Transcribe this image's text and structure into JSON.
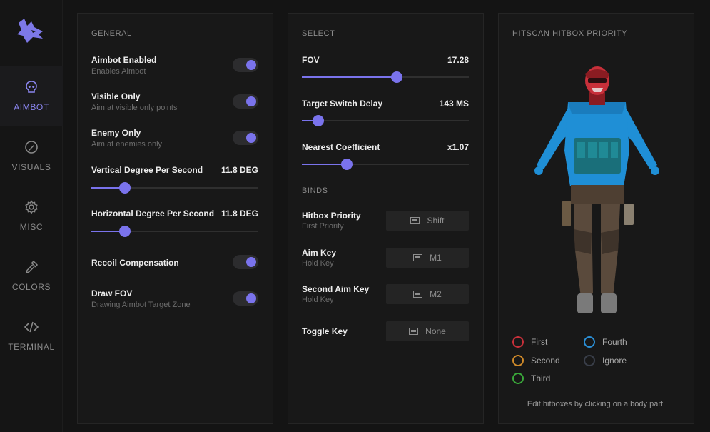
{
  "sidebar": {
    "items": [
      {
        "label": "AIMBOT",
        "icon": "skull-icon",
        "active": true
      },
      {
        "label": "VISUALS",
        "icon": "visuals-icon",
        "active": false
      },
      {
        "label": "MISC",
        "icon": "gear-icon",
        "active": false
      },
      {
        "label": "COLORS",
        "icon": "eyedropper-icon",
        "active": false
      },
      {
        "label": "TERMINAL",
        "icon": "code-icon",
        "active": false
      }
    ]
  },
  "general": {
    "title": "GENERAL",
    "aimbot_enabled": {
      "label": "Aimbot Enabled",
      "sub": "Enables Aimbot",
      "on": true
    },
    "visible_only": {
      "label": "Visible Only",
      "sub": "Aim at visible only points",
      "on": true
    },
    "enemy_only": {
      "label": "Enemy Only",
      "sub": "Aim at enemies only",
      "on": true
    },
    "vertical": {
      "label": "Vertical Degree Per Second",
      "value": "11.8 DEG",
      "fill": 0.2
    },
    "horizontal": {
      "label": "Horizontal Degree Per Second",
      "value": "11.8 DEG",
      "fill": 0.2
    },
    "recoil": {
      "label": "Recoil Compensation",
      "on": true
    },
    "draw_fov": {
      "label": "Draw FOV",
      "sub": "Drawing Aimbot Target Zone",
      "on": true
    }
  },
  "select": {
    "title": "SELECT",
    "fov": {
      "label": "FOV",
      "value": "17.28",
      "fill": 0.57
    },
    "switch_delay": {
      "label": "Target Switch Delay",
      "value": "143 MS",
      "fill": 0.1
    },
    "nearest": {
      "label": "Nearest Coefficient",
      "value": "x1.07",
      "fill": 0.27
    },
    "binds_title": "BINDS",
    "binds": [
      {
        "label": "Hitbox Priority",
        "sub": "First Priority",
        "key": "Shift"
      },
      {
        "label": "Aim Key",
        "sub": "Hold Key",
        "key": "M1"
      },
      {
        "label": "Second Aim Key",
        "sub": "Hold Key",
        "key": "M2"
      },
      {
        "label": "Toggle Key",
        "sub": "",
        "key": "None"
      }
    ]
  },
  "hitbox": {
    "title": "HITSCAN HITBOX PRIORITY",
    "legend": [
      {
        "label": "First",
        "color": "#c8303a"
      },
      {
        "label": "Fourth",
        "color": "#2b8fd6"
      },
      {
        "label": "Second",
        "color": "#d08a2a"
      },
      {
        "label": "Ignore",
        "color": "#3a3f4a"
      },
      {
        "label": "Third",
        "color": "#3aa83a"
      }
    ],
    "hint": "Edit hitboxes by clicking on a body part."
  },
  "colors": {
    "accent": "#7a73ec",
    "head": "#c8303a",
    "torso": "#1f8fd6"
  }
}
